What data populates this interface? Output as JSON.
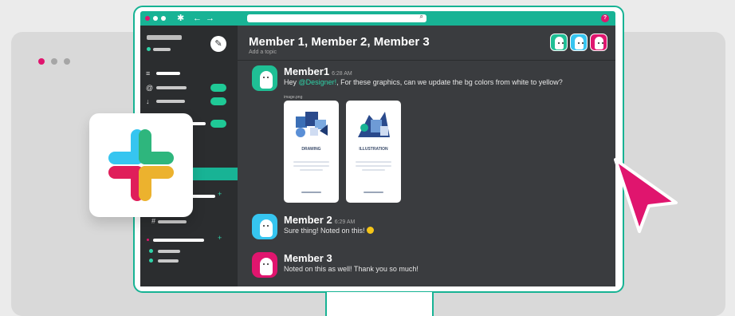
{
  "colors": {
    "accent": "#18b395",
    "pink": "#e0156e",
    "sidebar": "#2b2d2f",
    "main": "#3a3c3f",
    "cursor": "#e0156e",
    "avatar_green": "#1fbf95",
    "avatar_blue": "#36c5f0"
  },
  "topbar": {
    "slack_icon": "slack-icon",
    "search_icon": "search-icon",
    "help_icon": "help-icon",
    "help_label": "?"
  },
  "channel": {
    "title": "Member 1, Member 2, Member 3",
    "topic": "Add a topic"
  },
  "messages": [
    {
      "author": "Member1",
      "time": "6:28 AM",
      "text_before": "Hey ",
      "mention": "@Designer!",
      "text_after": ", For these graphics, can we update the bg colors from white to yellow?",
      "file_name": "image.png",
      "attachments": [
        {
          "label": "DRAWING"
        },
        {
          "label": "ILLUSTRATION"
        }
      ]
    },
    {
      "author": "Member 2",
      "time": "6:29 AM",
      "text": "Sure thing! Noted on this!"
    },
    {
      "author": "Member 3",
      "text": "Noted on this as well! Thank you so much!"
    }
  ]
}
